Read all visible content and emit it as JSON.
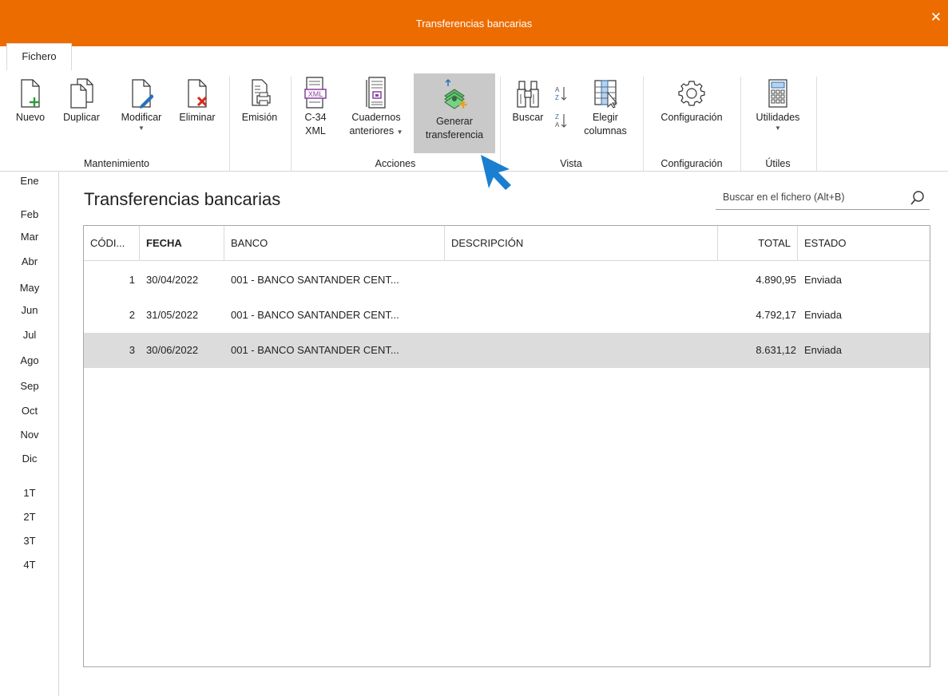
{
  "window": {
    "title": "Transferencias bancarias",
    "close_glyph": "✕"
  },
  "tabs": [
    {
      "label": "Fichero",
      "active": true
    }
  ],
  "ribbon": {
    "groups": [
      {
        "label": "Mantenimiento",
        "buttons": [
          {
            "label": "Nuevo",
            "icon": "new-document-icon"
          },
          {
            "label": "Duplicar",
            "icon": "duplicate-icon"
          },
          {
            "label": "Modificar",
            "icon": "edit-document-icon",
            "dropdown": true
          },
          {
            "label": "Eliminar",
            "icon": "delete-document-icon"
          }
        ]
      },
      {
        "label": "",
        "buttons": [
          {
            "label": "Emisión",
            "icon": "print-document-icon"
          }
        ]
      },
      {
        "label": "Acciones",
        "buttons": [
          {
            "label": "C-34",
            "label2": "XML",
            "icon": "xml-file-icon"
          },
          {
            "label": "Cuadernos",
            "label2": "anteriores",
            "icon": "notebook-icon",
            "dropdown": true
          },
          {
            "label": "Generar",
            "label2": "transferencia",
            "icon": "money-transfer-icon",
            "highlighted": true
          }
        ]
      },
      {
        "label": "Vista",
        "buttons": [
          {
            "label": "Buscar",
            "icon": "binoculars-icon"
          },
          {
            "label": "",
            "icon": "sort-az-icon"
          },
          {
            "label": "",
            "icon": "sort-za-icon"
          },
          {
            "label": "Elegir",
            "label2": "columnas",
            "icon": "choose-columns-icon"
          }
        ]
      },
      {
        "label": "Configuración",
        "buttons": [
          {
            "label": "Configuración",
            "icon": "gear-icon"
          }
        ]
      },
      {
        "label": "Útiles",
        "buttons": [
          {
            "label": "Utilidades",
            "icon": "calculator-icon",
            "dropdown": true
          }
        ]
      }
    ]
  },
  "months": [
    "Ene",
    "Feb",
    "Mar",
    "Abr",
    "May",
    "Jun",
    "Jul",
    "Ago",
    "Sep",
    "Oct",
    "Nov",
    "Dic"
  ],
  "quarters": [
    "1T",
    "2T",
    "3T",
    "4T"
  ],
  "page": {
    "title": "Transferencias bancarias",
    "search_placeholder": "Buscar en el fichero (Alt+B)"
  },
  "table": {
    "columns": [
      "CÓDI...",
      "FECHA",
      "BANCO",
      "DESCRIPCIÓN",
      "TOTAL",
      "ESTADO"
    ],
    "rows": [
      {
        "codigo": "1",
        "fecha": "30/04/2022",
        "banco": "001 - BANCO SANTANDER CENT...",
        "descripcion": "",
        "total": "4.890,95",
        "estado": "Enviada",
        "selected": false
      },
      {
        "codigo": "2",
        "fecha": "31/05/2022",
        "banco": "001 - BANCO SANTANDER CENT...",
        "descripcion": "",
        "total": "4.792,17",
        "estado": "Enviada",
        "selected": false
      },
      {
        "codigo": "3",
        "fecha": "30/06/2022",
        "banco": "001 - BANCO SANTANDER CENT...",
        "descripcion": "",
        "total": "8.631,12",
        "estado": "Enviada",
        "selected": true
      }
    ]
  },
  "colors": {
    "titlebar": "#ec6c00",
    "highlight": "#c9c9c9",
    "selected_row": "#dcdcdc",
    "add_green": "#2e9c3a",
    "delete_red": "#d42a1a",
    "edit_blue": "#2b6fb6",
    "xml_purple": "#8a3fa0",
    "cursor_blue": "#1a7fd0"
  }
}
